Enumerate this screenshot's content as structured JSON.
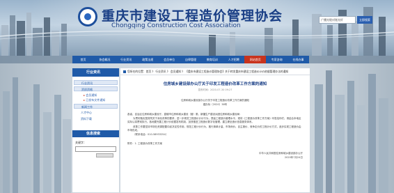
{
  "site": {
    "title": "重庆市建设工程造价管理协会",
    "subtitle": "Chongqing Construction Cost Association"
  },
  "search": {
    "value": "广播光缆对账光纤",
    "button": "立即搜索"
  },
  "nav": {
    "items": [
      "首页",
      "协会概况",
      "行业资讯",
      "政策法规",
      "会员单位",
      "自律管理",
      "教育培训",
      "人才招聘",
      "网站首页",
      "专家咨询",
      "在线办事"
    ],
    "active_index": 8
  },
  "sidebar": {
    "heading": "行业资讯",
    "items": [
      "行业资讯",
      "资质资格"
    ],
    "sub_items": [
      "会员通知",
      "已发布文件通知"
    ],
    "extra_items": [
      "新闻工作",
      "人才中心",
      "资料下载"
    ],
    "search_heading": "信息搜索",
    "keyword_label": "关键字："
  },
  "main": {
    "breadcrumb": "您所在的位置：首页 》 行业资讯 》 会员通知 》 【重庆市建设工程造价管理协会】关于转发重庆市建设工程造价计价依据管理办法的通知",
    "article_title": "住房城乡建设部办公厅关于印发工程造价改革工作方案的通知",
    "article_meta": "发布时间：2020-07-30 09:27",
    "body": [
      "各省、自治区住房和城乡建设厅，直辖市住房和城乡建设（管）委，新疆生产建设兵团住房和城乡建设局：",
      "为贯彻落实国务院关于深化改革的要求，进一步规范工程造价计价行为，提高工程造价管理水平，现将《工程造价改革工作方案》印发给你们，请结合本地区实际认真贯彻执行。各地要完善工程计价依据发布机制，加快推进工程造价数字化管理，建立健全造价信息服务体系。",
      "改革工作要坚持市场在资源配置中起决定性作用，规范工程计价行为，推行清单计量、市场询价、自主报价、竞争定价的工程计价方式，逐步实现工程造价由市场形成。"
    ],
    "center_lines": [
      "住房和城乡建设部办公厅关于印发工程造价改革工作方案的通知",
      "建办标〔2020〕38号"
    ],
    "contact": "（联系电话：010-58933254）",
    "attachment": "附件：1. 工程造价改革工作方案",
    "signature": "中华人民共和国住房和城乡建设部办公厅",
    "date": "2020年7月24日"
  },
  "colors": {
    "primary": "#1f5aa8",
    "active": "#c8331d",
    "title": "#1a3f86"
  }
}
